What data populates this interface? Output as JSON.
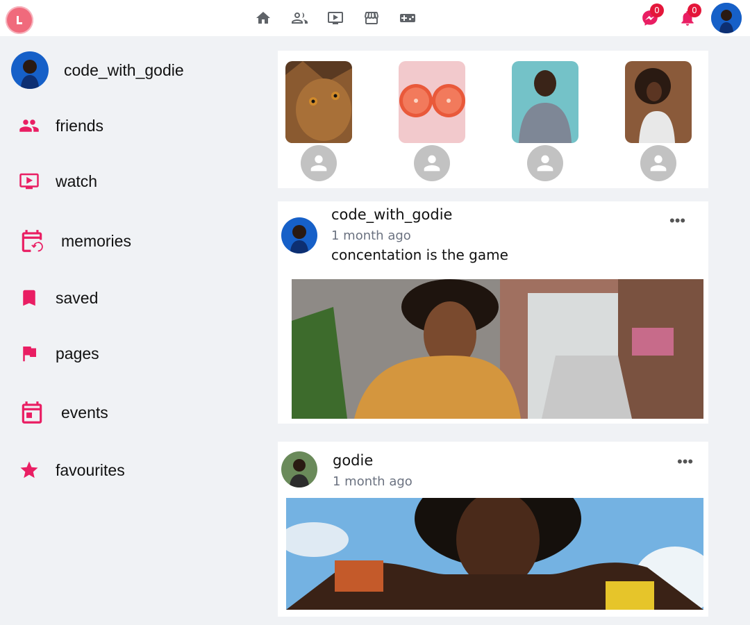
{
  "topbar": {
    "logo_letter": "L",
    "nav": [
      "home-icon",
      "friends-icon",
      "watch-icon",
      "marketplace-icon",
      "gaming-icon"
    ],
    "messenger_count": "0",
    "notifications_count": "0"
  },
  "sidebar": {
    "profile_name": "code_with_godie",
    "items": [
      {
        "label": "friends",
        "icon": "friends-icon"
      },
      {
        "label": "watch",
        "icon": "watch-icon"
      },
      {
        "label": "memories",
        "icon": "memories-icon"
      },
      {
        "label": "saved",
        "icon": "bookmark-icon"
      },
      {
        "label": "pages",
        "icon": "flag-icon"
      },
      {
        "label": "events",
        "icon": "calendar-icon"
      },
      {
        "label": "favourites",
        "icon": "star-icon"
      }
    ]
  },
  "stories": [
    "cat",
    "grapefruit",
    "man-portrait",
    "woman-portrait"
  ],
  "posts": [
    {
      "author": "code_with_godie",
      "time": "1 month ago",
      "text": "concentation is the game"
    },
    {
      "author": "godie",
      "time": "1 month ago",
      "text": ""
    }
  ],
  "colors": {
    "accent": "#e91e63",
    "badge": "#e4163a",
    "background": "#f0f2f5"
  }
}
